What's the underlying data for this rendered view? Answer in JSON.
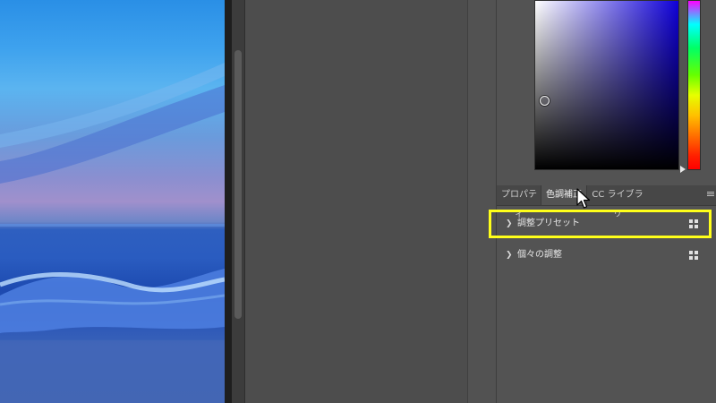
{
  "canvas": {
    "description_icon": "photo-canvas"
  },
  "tabs": {
    "properties": "プロパティ",
    "adjustments": "色調補正",
    "libraries": "CC ライブラリ",
    "active": "adjustments"
  },
  "adjustments_panel": {
    "sections": [
      {
        "label": "調整プリセット",
        "expanded": false,
        "icon": "grid-icon",
        "highlighted": true
      },
      {
        "label": "個々の調整",
        "expanded": false,
        "icon": "grid-icon",
        "highlighted": false
      }
    ]
  },
  "color_picker": {
    "hue_color": "#0f00d8",
    "highlight_color": "#ffff1a"
  },
  "cursor": {
    "icon": "arrow-cursor-icon"
  }
}
